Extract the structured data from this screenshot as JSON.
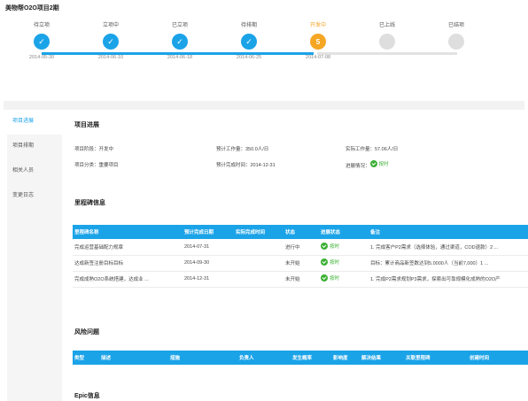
{
  "page_title": "美物帮O2O项目2期",
  "steps": [
    {
      "label": "待立项",
      "date": "2014-05-30",
      "state": "done"
    },
    {
      "label": "立项中",
      "date": "2014-06-10",
      "state": "done"
    },
    {
      "label": "已立项",
      "date": "2014-06-18",
      "state": "done"
    },
    {
      "label": "待排期",
      "date": "2014-06-25",
      "state": "done"
    },
    {
      "label": "开发中",
      "date": "2014-07-08",
      "state": "current",
      "number": "5"
    },
    {
      "label": "已上线",
      "date": "",
      "state": "todo"
    },
    {
      "label": "已结项",
      "date": "",
      "state": "todo"
    }
  ],
  "sidebar": {
    "items": [
      {
        "label": "项目进展"
      },
      {
        "label": "项目排期"
      },
      {
        "label": "相关人员"
      },
      {
        "label": "变更日志"
      }
    ]
  },
  "progress": {
    "title": "项目进展",
    "stage": "项目阶段：开发中",
    "category": "项目分类：重要项目",
    "est_work": "预计工作量：350.0人/日",
    "est_finish": "预计完成时间：2014-12-31",
    "actual_work": "实际工作量：57.06人/日",
    "status_label": "进展情况：",
    "status_value": "按时"
  },
  "milestones": {
    "title": "里程碑信息",
    "headers": [
      "里程碑名称",
      "预计完成日期",
      "实际完成时间",
      "状态",
      "进展状态",
      "备注"
    ],
    "rows": [
      {
        "name": "完成运营基础配力规章",
        "planned": "2014-07-31",
        "actual": "",
        "status": "进行中",
        "progress": "按时",
        "note": "1. 完成客户P2需求（选择体验，通过渠道，COD退款）2 ..."
      },
      {
        "name": "达成新签注册目标目标",
        "planned": "2014-09-30",
        "actual": "",
        "status": "未开始",
        "progress": "按时",
        "note": "目标：累计商品新签数达到5.0000人（当前7,000）1 ..."
      },
      {
        "name": "完成成熟O2O系统搭建，达成业 ...",
        "planned": "2014-12-31",
        "actual": "",
        "status": "未开始",
        "progress": "按时",
        "note": "1. 完成P2需求规划P3需求，探索出可靠规模化成熟的O2O产"
      }
    ]
  },
  "risks": {
    "title": "风险问题",
    "headers": [
      "类型",
      "描述",
      "措施",
      "负责人",
      "发生概率",
      "影响度",
      "解决结果",
      "关联里程碑",
      "创建时间"
    ]
  },
  "epic": {
    "title": "Epic信息"
  },
  "colors": {
    "accent": "#1ba3e8",
    "current": "#f5a623",
    "todo": "#dedede",
    "ok": "#3cb034"
  }
}
